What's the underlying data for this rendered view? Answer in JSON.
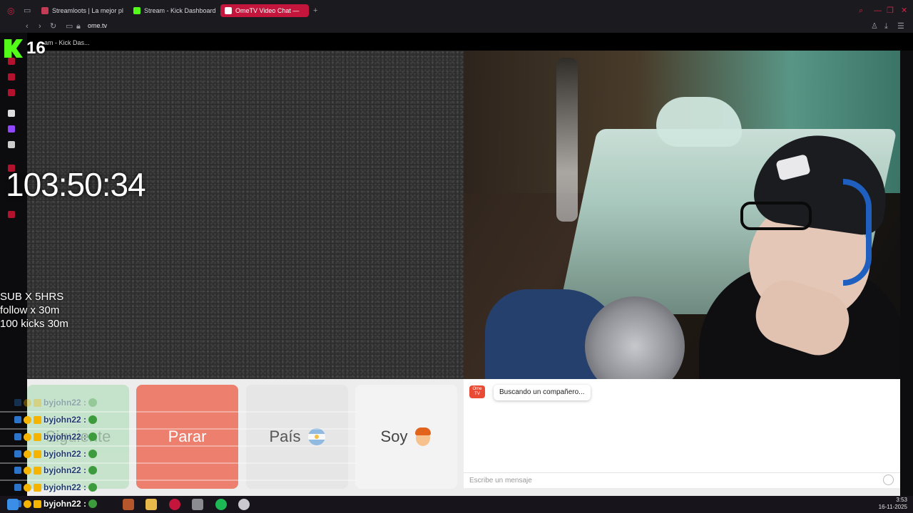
{
  "browser": {
    "tabs": [
      {
        "label": "Streamloots | La mejor pl",
        "color": "#c33b54"
      },
      {
        "label": "Stream - Kick Dashboard",
        "color": "#53fc18"
      },
      {
        "label": "OmeTV Video Chat —",
        "color": "#e94b35"
      }
    ],
    "url": "ome.tv"
  },
  "overlay": {
    "viewer_count": "16",
    "kick_tab_label": "am - Kick Das...",
    "timer": "103:50:34",
    "goals": [
      "SUB X 5HRS",
      "follow x 30m",
      "100 kicks 30m"
    ]
  },
  "controls": {
    "next_label": "Siguiente",
    "stop_label": "Parar",
    "country_label": "País",
    "iam_label": "Soy"
  },
  "chat_panel": {
    "ome_badge": "Ome TV",
    "status": "Buscando un compañero...",
    "input_placeholder": "Escribe un mensaje"
  },
  "chat_overlay": {
    "rows": [
      {
        "user": "byjohn22 :"
      },
      {
        "user": "byjohn22 :"
      },
      {
        "user": "byjohn22 :"
      },
      {
        "user": "byjohn22 :"
      },
      {
        "user": "byjohn22 :"
      },
      {
        "user": "byjohn22 :"
      },
      {
        "user": "byjohn22 :"
      }
    ]
  },
  "taskbar": {
    "time": "3:53",
    "date": "16-11-2025"
  },
  "colors": {
    "accent_tab": "#c4163c",
    "kick_green": "#53fc18",
    "stop_button": "#ec7f6e",
    "next_button": "#bfe1c6"
  }
}
